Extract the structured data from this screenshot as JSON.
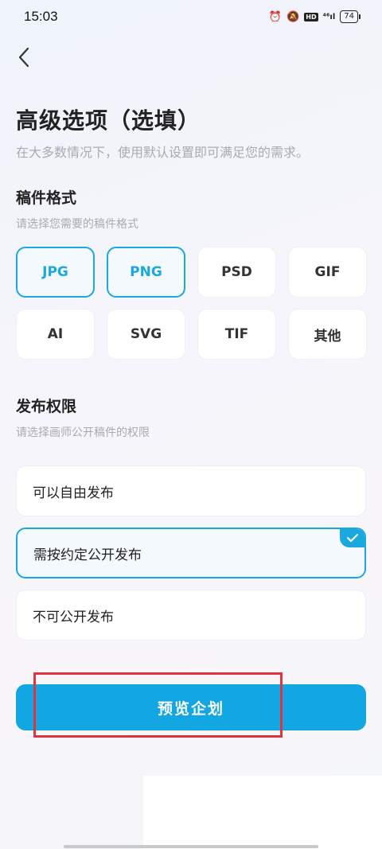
{
  "status_bar": {
    "time": "15:03",
    "signal": "⁴⁶ıl",
    "hd": "HD",
    "battery": "74"
  },
  "page": {
    "title": "高级选项（选填）",
    "subtitle": "在大多数情况下，使用默认设置即可满足您的需求。"
  },
  "format_section": {
    "title": "稿件格式",
    "hint": "请选择您需要的稿件格式",
    "options": [
      {
        "label": "JPG",
        "selected": true
      },
      {
        "label": "PNG",
        "selected": true
      },
      {
        "label": "PSD",
        "selected": false
      },
      {
        "label": "GIF",
        "selected": false
      },
      {
        "label": "AI",
        "selected": false
      },
      {
        "label": "SVG",
        "selected": false
      },
      {
        "label": "TIF",
        "selected": false
      },
      {
        "label": "其他",
        "selected": false
      }
    ]
  },
  "permission_section": {
    "title": "发布权限",
    "hint": "请选择画师公开稿件的权限",
    "options": [
      {
        "label": "可以自由发布",
        "selected": false
      },
      {
        "label": "需按约定公开发布",
        "selected": true
      },
      {
        "label": "不可公开发布",
        "selected": false
      }
    ]
  },
  "actions": {
    "preview_label": "预览企划"
  },
  "colors": {
    "accent": "#12a6e2",
    "highlight": "#e0323f"
  }
}
